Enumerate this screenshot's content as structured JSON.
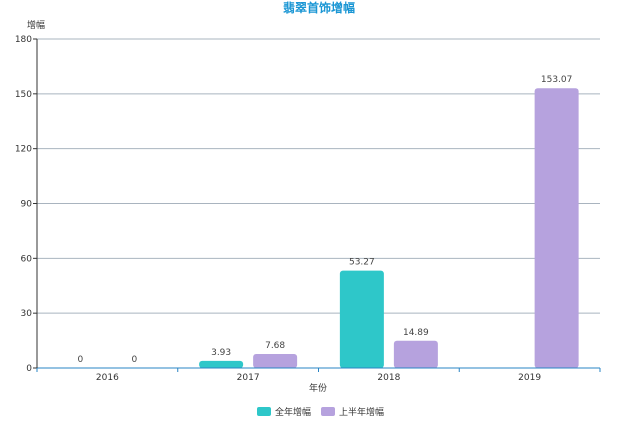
{
  "chart_data": {
    "type": "bar",
    "title": "翡翠首饰增幅",
    "ylabel": "增幅",
    "xlabel": "年份",
    "categories": [
      "2016",
      "2017",
      "2018",
      "2019"
    ],
    "ylim": [
      0,
      180
    ],
    "yticks": [
      0,
      30,
      60,
      90,
      120,
      150,
      180
    ],
    "grid": true,
    "legend_position": "bottom",
    "series": [
      {
        "name": "全年增幅",
        "color": "#2ec7c9",
        "values": [
          0,
          3.93,
          53.27,
          null
        ],
        "labels": [
          "0",
          "3.93",
          "53.27",
          ""
        ]
      },
      {
        "name": "上半年增幅",
        "color": "#b6a2de",
        "values": [
          0,
          7.68,
          14.89,
          153.07
        ],
        "labels": [
          "0",
          "7.68",
          "14.89",
          "153.07"
        ]
      }
    ]
  }
}
